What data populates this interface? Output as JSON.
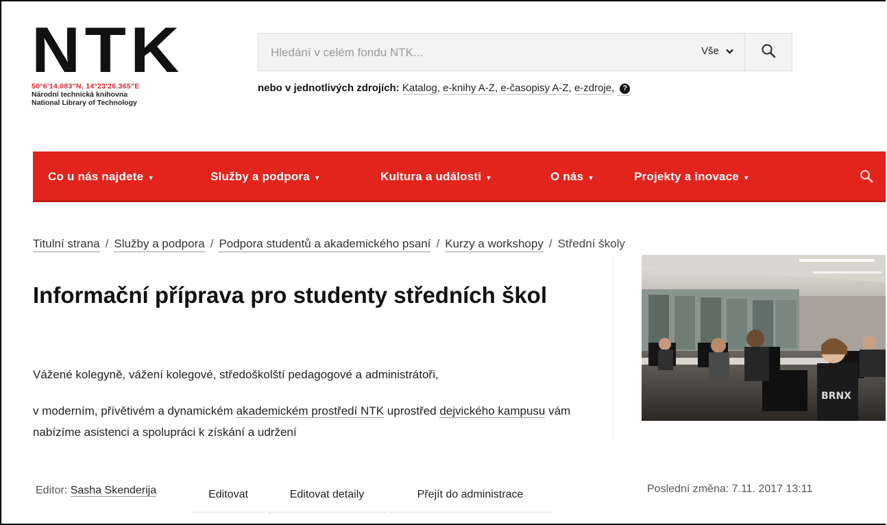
{
  "logo": {
    "mark": "NTK",
    "coordinates": "50°6'14.083\"N, 14°23'26.365\"E",
    "name_cz": "Národní technická knihovna",
    "name_en": "National Library of Technology"
  },
  "search": {
    "placeholder": "Hledání v celém fondu NTK...",
    "scope_label": "Vše",
    "sources_lead": "nebo v jednotlivých zdrojích:",
    "sources": [
      "Katalog",
      "e-knihy A-Z",
      "e-časopisy A-Z",
      "e-zdroje"
    ]
  },
  "nav": {
    "items": [
      {
        "label": "Co u nás najdete"
      },
      {
        "label": "Služby a podpora"
      },
      {
        "label": "Kultura a události"
      },
      {
        "label": "O nás"
      },
      {
        "label": "Projekty a inovace"
      }
    ],
    "caret": "▾"
  },
  "breadcrumb": {
    "items": [
      "Titulní strana",
      "Služby a podpora",
      "Podpora studentů a akademického psaní",
      "Kurzy a workshopy"
    ],
    "current": "Střední školy",
    "separator": "/"
  },
  "page": {
    "title": "Informační příprava pro studenty středních škol",
    "para1": "Vážené kolegyně, vážení kolegové, středoškolští pedagogové a administrátoři,",
    "para2_a": "v moderním, přívětivém a dynamickém ",
    "para2_link1": "akademickém prostředí NTK",
    "para2_b": " uprostřed ",
    "para2_link2": "dejvického kampusu",
    "para2_c": " vám nabízíme asistenci a spolupráci k získání a udržení"
  },
  "footer": {
    "editor_label": "Editor:",
    "editor_name": "Sasha Skenderija",
    "actions": [
      "Editovat",
      "Editovat detaily",
      "Přejít do administrace"
    ],
    "last_modified": "Poslední změna: 7.11. 2017 13:11"
  },
  "colors": {
    "nav_bg": "#e2241d",
    "coords": "#d6262d"
  },
  "icons": {
    "search": "search-icon",
    "nav_search": "search-icon",
    "help": "question-circle-icon",
    "chevron": "chevron-down-icon"
  }
}
